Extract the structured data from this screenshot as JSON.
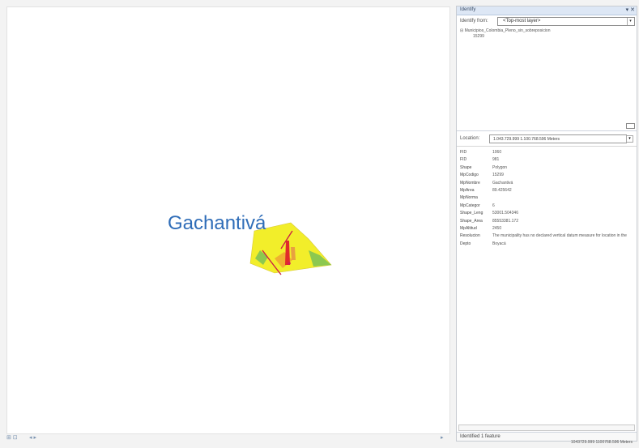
{
  "map": {
    "feature_label": "Gachantivá",
    "bottom_controls": [
      "⊞ ⊡",
      "◂ ▸",
      "▸"
    ]
  },
  "identify": {
    "title": "Identify",
    "window_controls": "▾ ✕",
    "identify_from_label": "Identify from:",
    "identify_from_value": "<Top-most layer>",
    "tree_layer": "Municipios_Colombia_Pleno_sin_sobreposicion",
    "tree_feature": "15299",
    "location_label": "Location:",
    "location_value": "1.043.729.999  1.100.768.596 Meters",
    "fields": [
      {
        "k": "FID",
        "v": "1060"
      },
      {
        "k": "FID",
        "v": "981"
      },
      {
        "k": "Shape",
        "v": "Polygon"
      },
      {
        "k": "MpCodigo",
        "v": "15299"
      },
      {
        "k": "MpNombre",
        "v": "Gachantivá"
      },
      {
        "k": "MpArea",
        "v": "89.425642"
      },
      {
        "k": "MpNorma",
        "v": ""
      },
      {
        "k": "MpCategor",
        "v": "6"
      },
      {
        "k": "Shape_Leng",
        "v": "53001.504346"
      },
      {
        "k": "Shape_Area",
        "v": "85553381.172"
      },
      {
        "k": "MpAltitud",
        "v": "2450"
      },
      {
        "k": "Resolucion",
        "v": "The municipality has no declared vertical datum measure for location in the"
      },
      {
        "k": "Depto",
        "v": "Boyacá"
      }
    ],
    "status": "Identified 1 feature"
  },
  "statusbar": {
    "coordinates": "1043729.999  1100768.596 Meters"
  }
}
